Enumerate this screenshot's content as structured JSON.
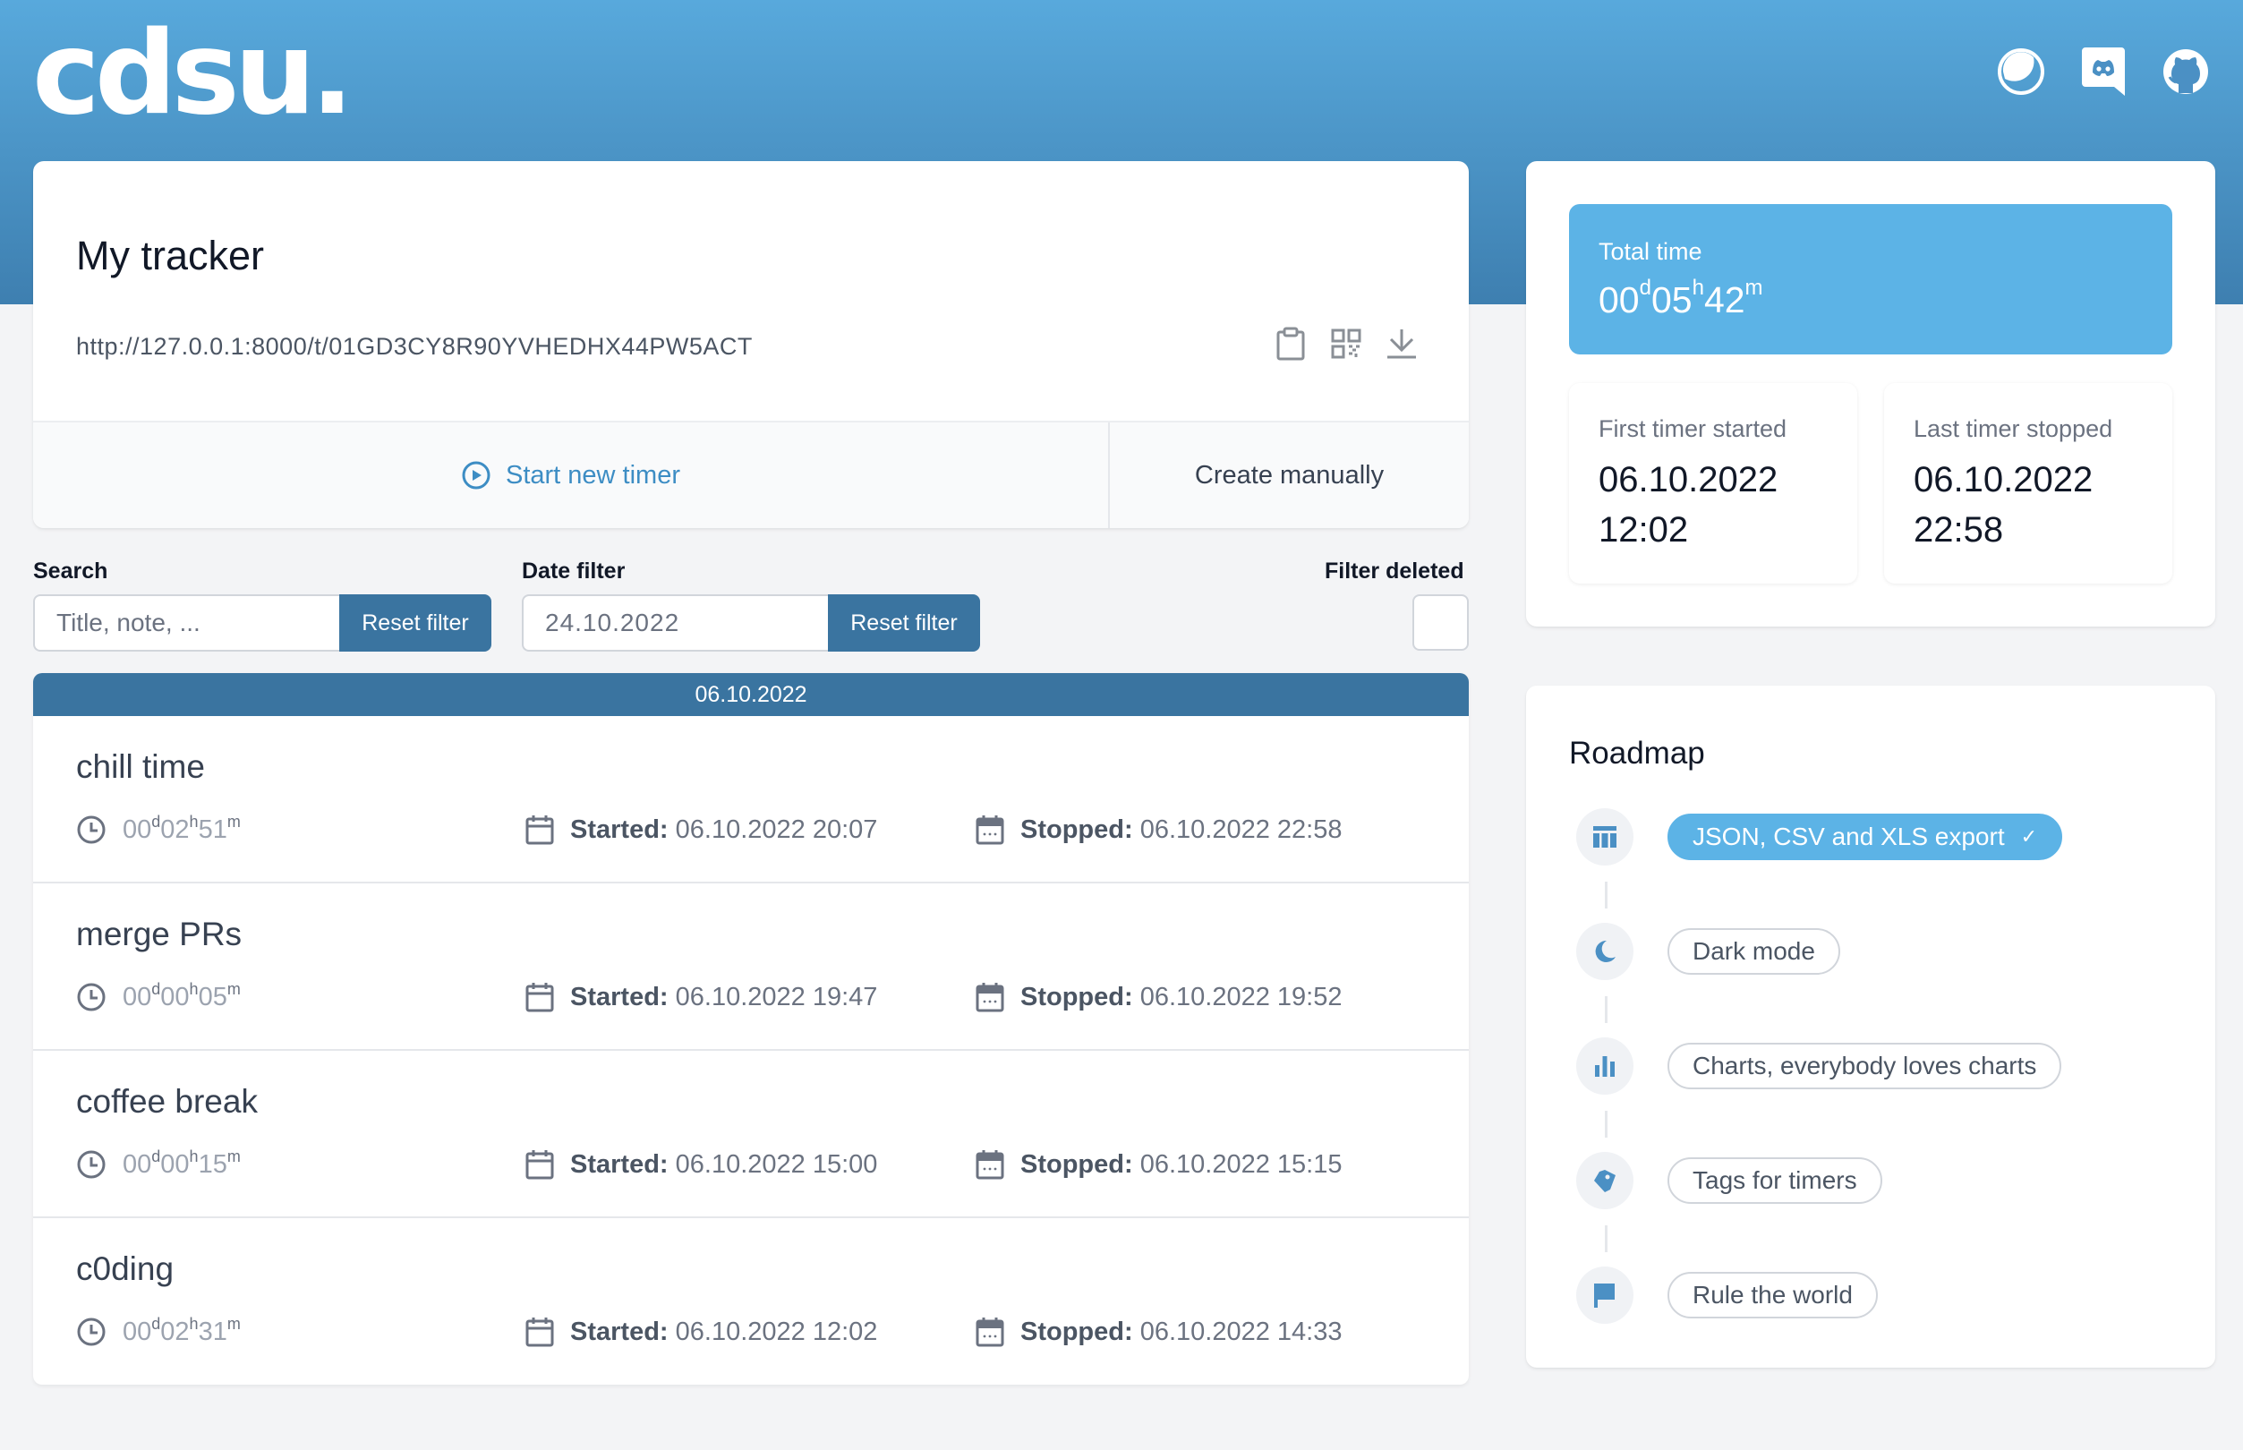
{
  "header": {
    "logo_text": "cdsu.",
    "icons": [
      "theme-toggle-icon",
      "discord-icon",
      "github-icon"
    ]
  },
  "tracker": {
    "title": "My tracker",
    "url": "http://127.0.0.1:8000/t/01GD3CY8R90YVHEDHX44PW5ACT",
    "actions": {
      "copy_icon": "clipboard-icon",
      "qr_icon": "qr-code-icon",
      "download_icon": "download-icon"
    },
    "start_label": "Start new timer",
    "create_label": "Create manually"
  },
  "filters": {
    "search_label": "Search",
    "search_placeholder": "Title, note, ...",
    "search_value": "",
    "search_reset": "Reset filter",
    "date_label": "Date filter",
    "date_placeholder": "24.10.2022",
    "date_value": "",
    "date_reset": "Reset filter",
    "deleted_label": "Filter deleted",
    "deleted_checked": false
  },
  "timer_group": {
    "date": "06.10.2022",
    "started_label": "Started:",
    "stopped_label": "Stopped:",
    "timers": [
      {
        "title": "chill time",
        "days": "00",
        "hours": "02",
        "minutes": "51",
        "started": "06.10.2022 20:07",
        "stopped": "06.10.2022 22:58"
      },
      {
        "title": "merge PRs",
        "days": "00",
        "hours": "00",
        "minutes": "05",
        "started": "06.10.2022 19:47",
        "stopped": "06.10.2022 19:52"
      },
      {
        "title": "coffee break",
        "days": "00",
        "hours": "00",
        "minutes": "15",
        "started": "06.10.2022 15:00",
        "stopped": "06.10.2022 15:15"
      },
      {
        "title": "c0ding",
        "days": "00",
        "hours": "02",
        "minutes": "31",
        "started": "06.10.2022 12:02",
        "stopped": "06.10.2022 14:33"
      }
    ]
  },
  "stats": {
    "total_label": "Total time",
    "total_days": "00",
    "total_hours": "05",
    "total_minutes": "42",
    "unit_d": "d",
    "unit_h": "h",
    "unit_m": "m",
    "first_label": "First timer started",
    "first_date": "06.10.2022",
    "first_time": "12:02",
    "last_label": "Last timer stopped",
    "last_date": "06.10.2022",
    "last_time": "22:58"
  },
  "roadmap": {
    "title": "Roadmap",
    "items": [
      {
        "label": "JSON, CSV and XLS export",
        "icon": "table-icon",
        "done": true,
        "check": "✓"
      },
      {
        "label": "Dark mode",
        "icon": "moon-icon",
        "done": false
      },
      {
        "label": "Charts, everybody loves charts",
        "icon": "bar-chart-icon",
        "done": false
      },
      {
        "label": "Tags for timers",
        "icon": "tag-icon",
        "done": false
      },
      {
        "label": "Rule the world",
        "icon": "flag-icon",
        "done": false
      }
    ]
  },
  "colors": {
    "accent": "#5cb3e6",
    "primary_dark": "#3a74a0",
    "header_top": "#58a9dc",
    "header_bottom": "#3e7fb0",
    "background": "#f3f4f6"
  }
}
